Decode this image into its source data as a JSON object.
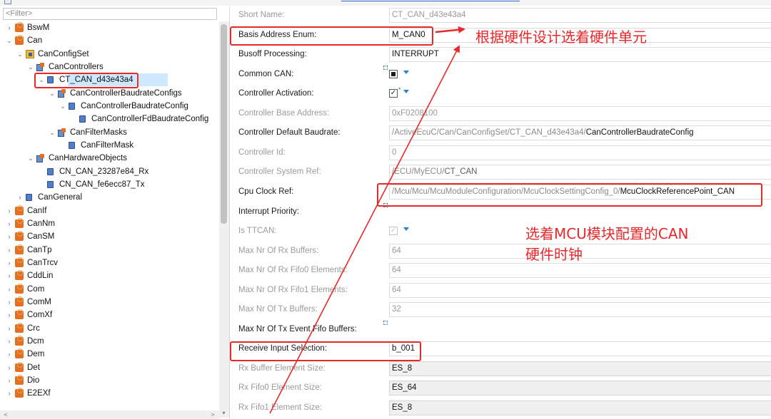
{
  "filter": {
    "placeholder": "<Filter>"
  },
  "tree": [
    {
      "label": "BswM",
      "twisty": "›",
      "icon": "module-icon",
      "indent": 0
    },
    {
      "label": "Can",
      "twisty": "⌄",
      "icon": "module-icon",
      "indent": 0
    },
    {
      "label": "CanConfigSet",
      "twisty": "⌄",
      "icon": "container-icon",
      "indent": 1
    },
    {
      "label": "CanControllers",
      "twisty": "⌄",
      "icon": "container-list-icon",
      "indent": 2
    },
    {
      "label": "CT_CAN_d43e43a4",
      "twisty": "⌄",
      "icon": "object-icon",
      "indent": 3,
      "selected": true
    },
    {
      "label": "CanControllerBaudrateConfigs",
      "twisty": "⌄",
      "icon": "container-list-icon",
      "indent": 4
    },
    {
      "label": "CanControllerBaudrateConfig",
      "twisty": "⌄",
      "icon": "object-icon",
      "indent": 5
    },
    {
      "label": "CanControllerFdBaudrateConfig",
      "twisty": "",
      "icon": "object-icon",
      "indent": 6
    },
    {
      "label": "CanFilterMasks",
      "twisty": "⌄",
      "icon": "container-list-icon",
      "indent": 4
    },
    {
      "label": "CanFilterMask",
      "twisty": "",
      "icon": "object-icon",
      "indent": 5
    },
    {
      "label": "CanHardwareObjects",
      "twisty": "⌄",
      "icon": "container-list-icon",
      "indent": 2
    },
    {
      "label": "CN_CAN_23287e84_Rx",
      "twisty": "",
      "icon": "object-icon",
      "indent": 3
    },
    {
      "label": "CN_CAN_fe6ecc87_Tx",
      "twisty": "",
      "icon": "object-icon",
      "indent": 3
    },
    {
      "label": "CanGeneral",
      "twisty": "›",
      "icon": "object-icon",
      "indent": 1
    },
    {
      "label": "CanIf",
      "twisty": "›",
      "icon": "module-icon",
      "indent": 0
    },
    {
      "label": "CanNm",
      "twisty": "›",
      "icon": "module-icon",
      "indent": 0
    },
    {
      "label": "CanSM",
      "twisty": "›",
      "icon": "module-icon",
      "indent": 0
    },
    {
      "label": "CanTp",
      "twisty": "›",
      "icon": "module-icon",
      "indent": 0
    },
    {
      "label": "CanTrcv",
      "twisty": "›",
      "icon": "module-icon",
      "indent": 0
    },
    {
      "label": "CddLin",
      "twisty": "›",
      "icon": "module-icon",
      "indent": 0
    },
    {
      "label": "Com",
      "twisty": "›",
      "icon": "module-icon",
      "indent": 0
    },
    {
      "label": "ComM",
      "twisty": "›",
      "icon": "module-icon",
      "indent": 0
    },
    {
      "label": "ComXf",
      "twisty": "›",
      "icon": "module-icon",
      "indent": 0
    },
    {
      "label": "Crc",
      "twisty": "›",
      "icon": "module-icon",
      "indent": 0
    },
    {
      "label": "Dcm",
      "twisty": "›",
      "icon": "module-icon",
      "indent": 0
    },
    {
      "label": "Dem",
      "twisty": "›",
      "icon": "module-icon",
      "indent": 0
    },
    {
      "label": "Det",
      "twisty": "›",
      "icon": "module-icon",
      "indent": 0
    },
    {
      "label": "Dio",
      "twisty": "›",
      "icon": "module-icon",
      "indent": 0
    },
    {
      "label": "E2EXf",
      "twisty": "›",
      "icon": "module-icon",
      "indent": 0
    }
  ],
  "scroll": {
    "left_arrow": "<",
    "right_arrow": ">",
    "down_arrow": "▾"
  },
  "props": [
    {
      "label": "Short Name:",
      "disabled": true,
      "kind": "text",
      "value": "CT_CAN_d43e43a4",
      "width": 536
    },
    {
      "label": "Basis Address Enum:",
      "disabled": false,
      "kind": "text",
      "value": "M_CAN0",
      "width": 536
    },
    {
      "label": "Busoff Processing:",
      "disabled": false,
      "kind": "text",
      "value": "INTERRUPT",
      "width": 536
    },
    {
      "label": "Common CAN:",
      "disabled": false,
      "kind": "checkbox",
      "checked": "filled",
      "dropdown": true,
      "mark": true
    },
    {
      "label": "Controller Activation:",
      "disabled": false,
      "kind": "checkbox",
      "checked": "tick",
      "dropdown": true
    },
    {
      "label": "Controller Base Address:",
      "disabled": true,
      "kind": "text",
      "value": "0xF0208100",
      "width": 536
    },
    {
      "label": "Controller Default Baudrate:",
      "disabled": false,
      "kind": "ref",
      "dim": "/ActiveEcuC/Can/CanConfigSet/CT_CAN_d43e43a4/",
      "value": "CanControllerBaudrateConfig",
      "width": 536
    },
    {
      "label": "Controller Id:",
      "disabled": true,
      "kind": "text",
      "value": "0",
      "width": 536
    },
    {
      "label": "Controller System Ref:",
      "disabled": true,
      "kind": "ref",
      "dim": "/ECU/MyECU/",
      "value": "CT_CAN",
      "width": 536
    },
    {
      "label": "Cpu Clock Ref:",
      "disabled": false,
      "kind": "ref",
      "dim": "/Mcu/Mcu/McuModuleConfiguration/McuClockSettingConfig_0/",
      "value": "McuClockReferencePoint_CAN",
      "width": 536
    },
    {
      "label": "Interrupt Priority:",
      "disabled": false,
      "kind": "empty",
      "mark": true
    },
    {
      "label": "Is TTCAN:",
      "disabled": true,
      "kind": "checkbox",
      "checked": "tick-dis",
      "dropdown": true
    },
    {
      "label": "Max Nr Of Rx Buffers:",
      "disabled": true,
      "kind": "text",
      "value": "64",
      "width": 536
    },
    {
      "label": "Max Nr Of Rx Fifo0 Elements:",
      "disabled": true,
      "kind": "text",
      "value": "64",
      "width": 536
    },
    {
      "label": "Max Nr Of Rx Fifo1 Elements:",
      "disabled": true,
      "kind": "text",
      "value": "64",
      "width": 536
    },
    {
      "label": "Max Nr Of Tx Buffers:",
      "disabled": true,
      "kind": "text",
      "value": "32",
      "width": 536
    },
    {
      "label": "Max Nr Of Tx Event Fifo Buffers:",
      "disabled": false,
      "kind": "empty",
      "mark": true
    },
    {
      "label": "Receive Input Selection:",
      "disabled": false,
      "kind": "text",
      "value": "b_001",
      "width": 536
    },
    {
      "label": "Rx Buffer Element Size:",
      "disabled": true,
      "kind": "ro",
      "value": "ES_8",
      "width": 536
    },
    {
      "label": "Rx Fifo0 Element Size:",
      "disabled": true,
      "kind": "ro",
      "value": "ES_64",
      "width": 536
    },
    {
      "label": "Rx Fifo1 Element Size:",
      "disabled": true,
      "kind": "ro",
      "value": "ES_8",
      "width": 536
    }
  ],
  "annotations": {
    "hardware_unit": "根据硬件设计选着硬件单元",
    "mcu_clock_line1": "选着MCU模块配置的CAN",
    "mcu_clock_line2": "硬件时钟"
  },
  "colors": {
    "annotation_red": "#e8282b",
    "selection_blue": "#cde8ff",
    "dropdown_blue": "#2a7fd0"
  }
}
